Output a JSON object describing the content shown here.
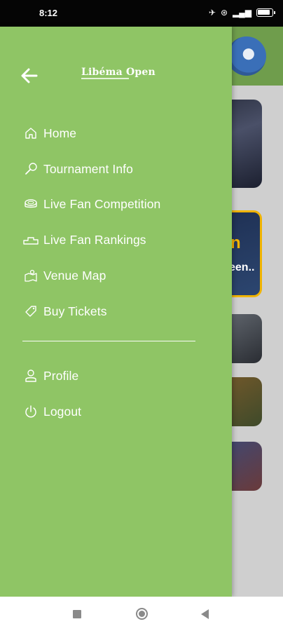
{
  "status_bar": {
    "time": "8:12"
  },
  "drawer": {
    "logo_text": "Libéma Open",
    "menu": [
      {
        "label": "Home",
        "icon": "home-icon"
      },
      {
        "label": "Tournament Info",
        "icon": "racket-icon"
      },
      {
        "label": "Live Fan Competition",
        "icon": "stadium-icon"
      },
      {
        "label": "Live Fan Rankings",
        "icon": "podium-icon"
      },
      {
        "label": "Venue Map",
        "icon": "map-icon"
      },
      {
        "label": "Buy Tickets",
        "icon": "ticket-icon"
      }
    ],
    "account_menu": [
      {
        "label": "Profile",
        "icon": "profile-icon"
      },
      {
        "label": "Logout",
        "icon": "power-icon"
      }
    ]
  },
  "background": {
    "promo_text_1": "n",
    "promo_text_2": "een.."
  },
  "colors": {
    "drawer_bg": "#8fc565",
    "header_bg": "#6f9d4c",
    "accent_border": "#f0b400"
  }
}
